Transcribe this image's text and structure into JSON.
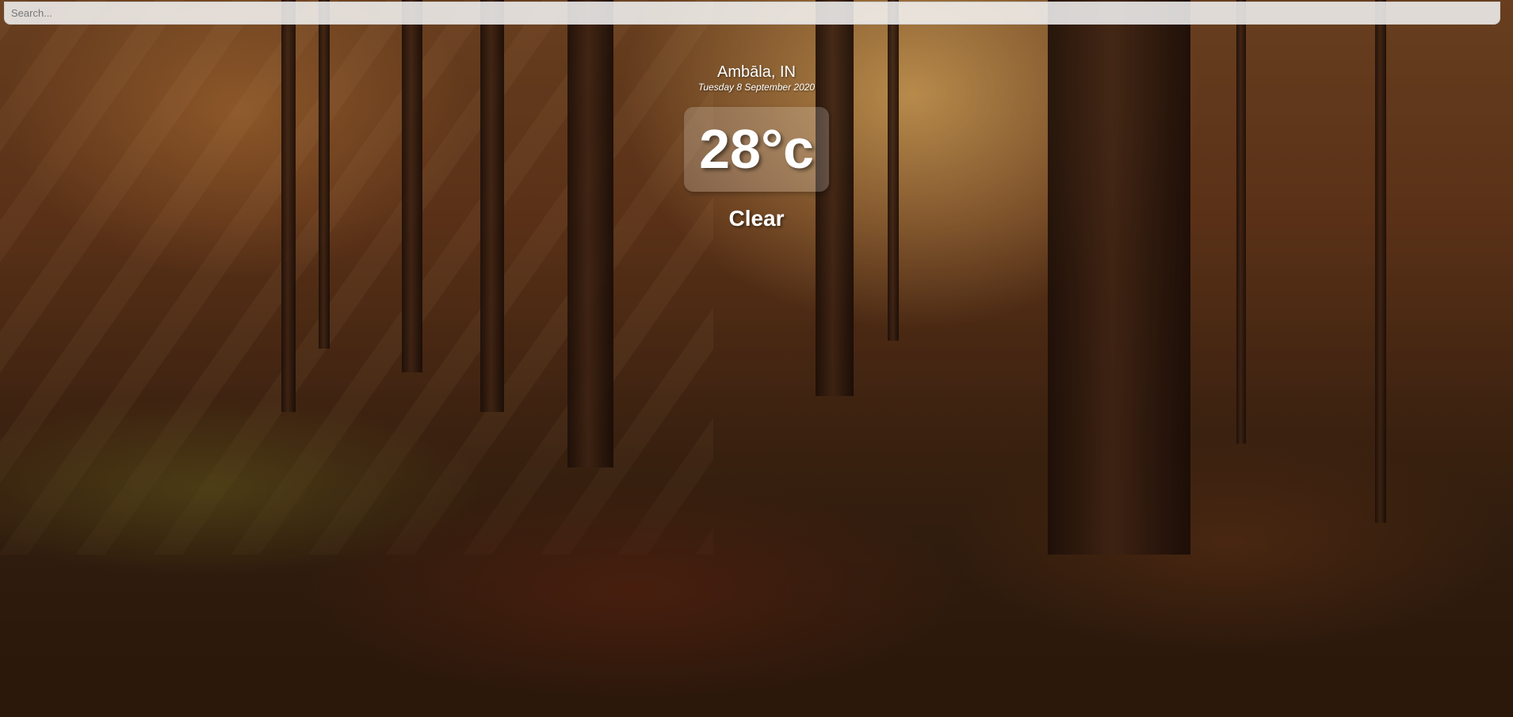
{
  "search": {
    "placeholder": "Search..."
  },
  "weather": {
    "location": "Ambāla, IN",
    "date": "Tuesday 8 September 2020",
    "temperature": "28°c",
    "condition": "Clear"
  },
  "colors": {
    "text": "#ffffff",
    "temp_box_bg": "rgba(255,255,255,0.2)"
  }
}
